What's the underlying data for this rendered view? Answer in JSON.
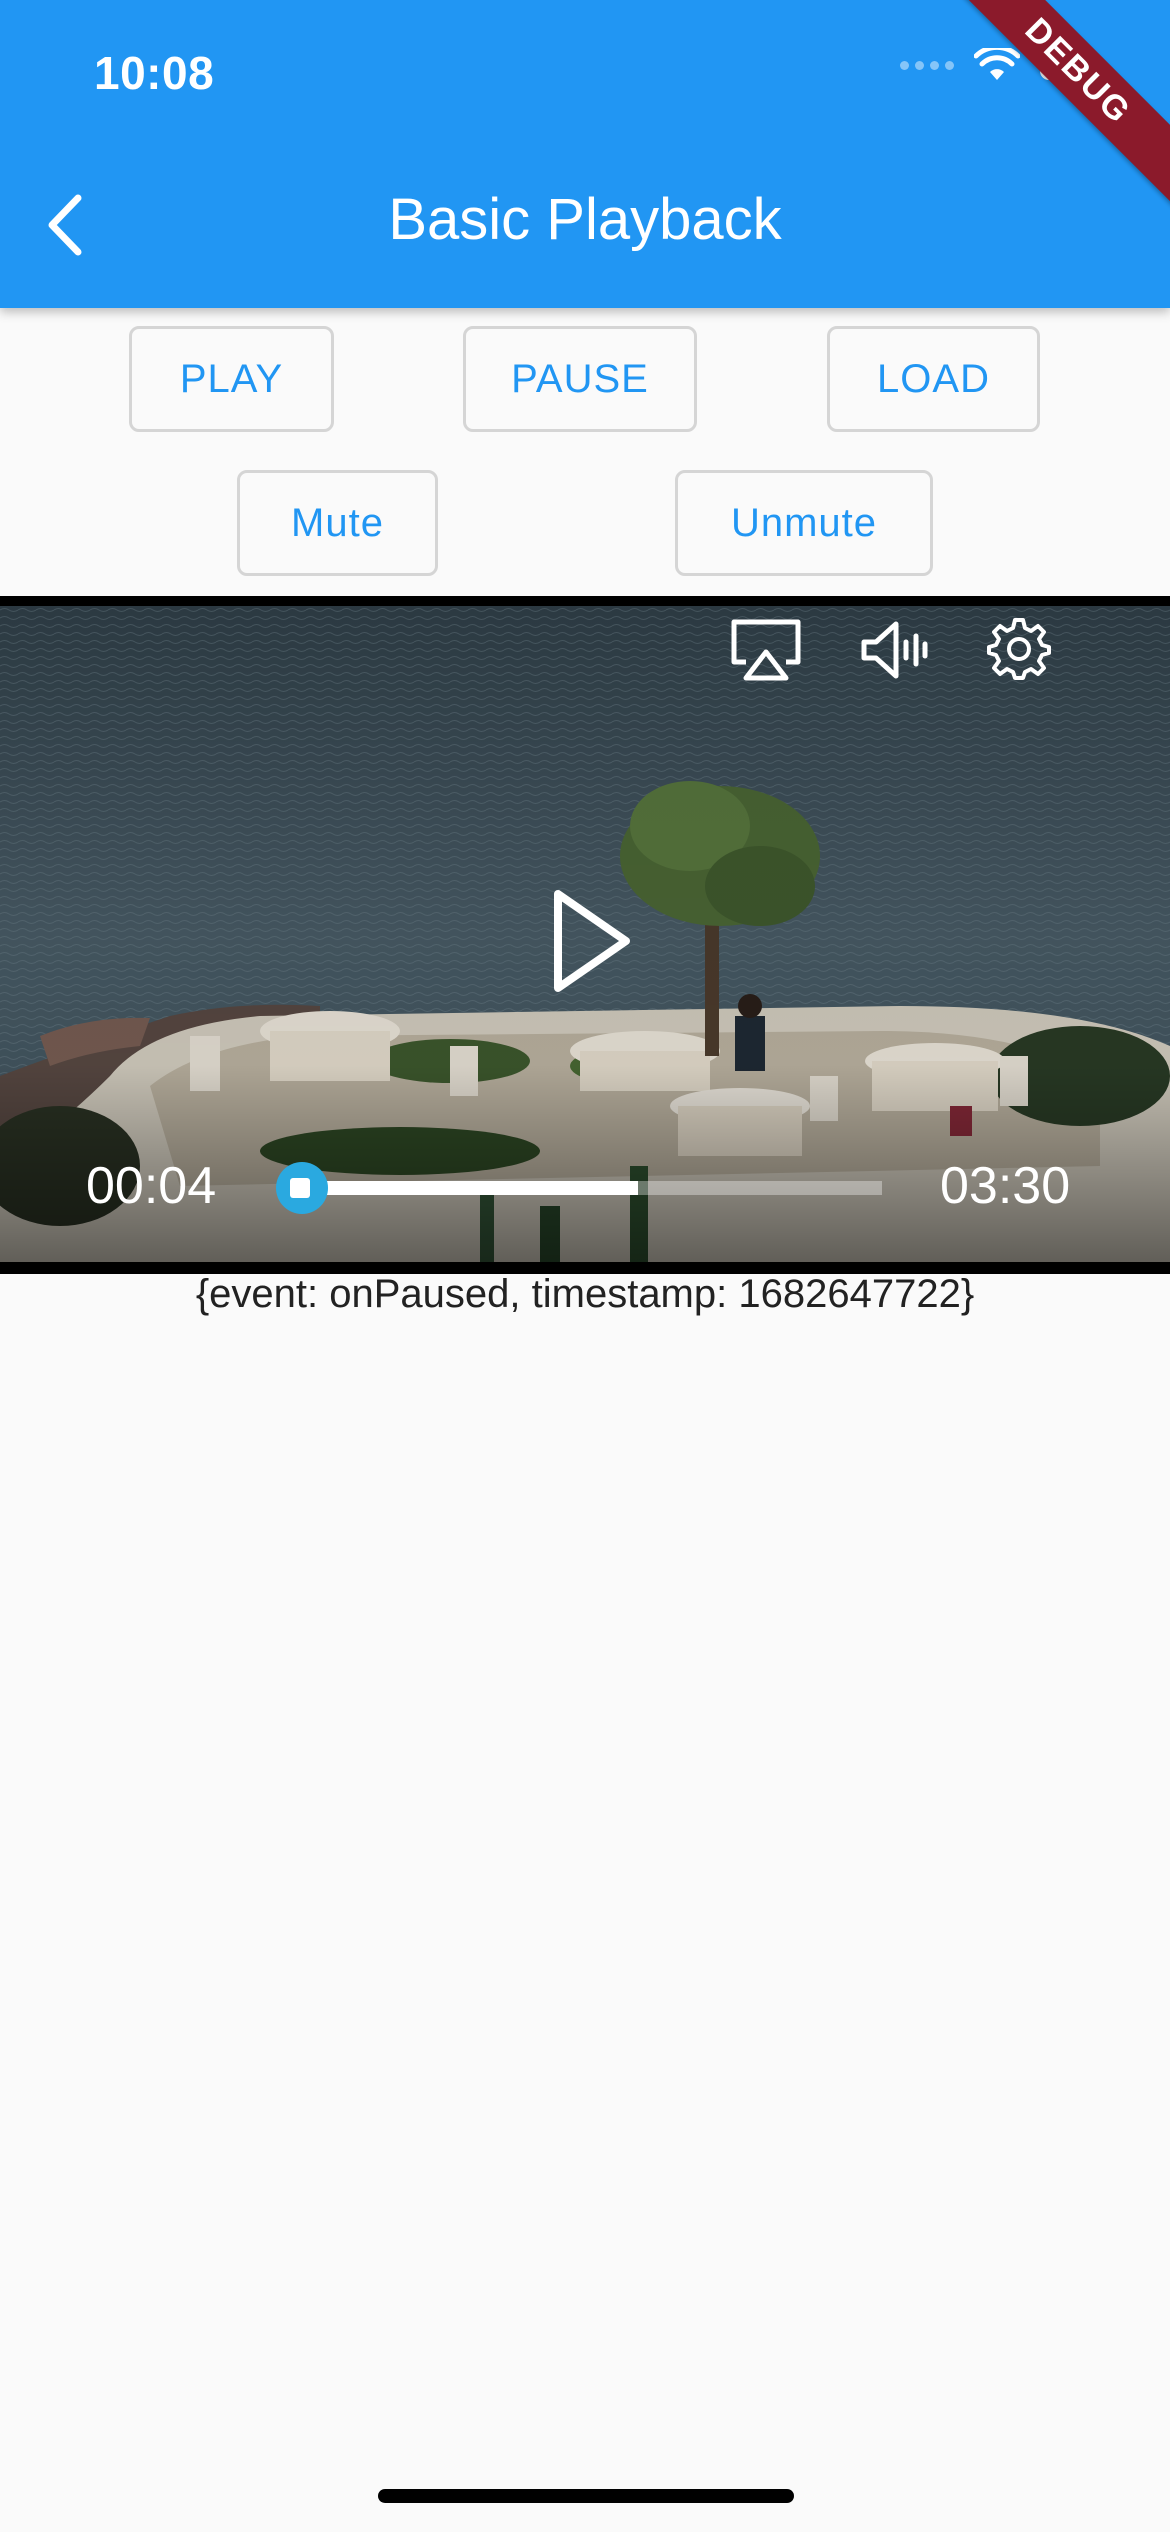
{
  "status_bar": {
    "time": "10:08",
    "icons": [
      "signal-dots-icon",
      "wifi-icon",
      "battery-icon"
    ]
  },
  "debug_banner": "DEBUG",
  "app_bar": {
    "title": "Basic Playback",
    "back_icon": "chevron-left-icon",
    "color": "#2196f3"
  },
  "controls": {
    "play": "PLAY",
    "pause": "PAUSE",
    "load": "LOAD",
    "mute": "Mute",
    "unmute": "Unmute"
  },
  "player": {
    "position": "00:04",
    "duration": "03:30",
    "played_fraction": 0.019,
    "buffered_fraction": 0.58,
    "state": "paused",
    "icons": [
      "airplay-icon",
      "volume-icon",
      "settings-gear-icon",
      "play-icon"
    ],
    "accent": "#2aa9e0"
  },
  "event_log": "{event: onPaused, timestamp: 1682647722}"
}
